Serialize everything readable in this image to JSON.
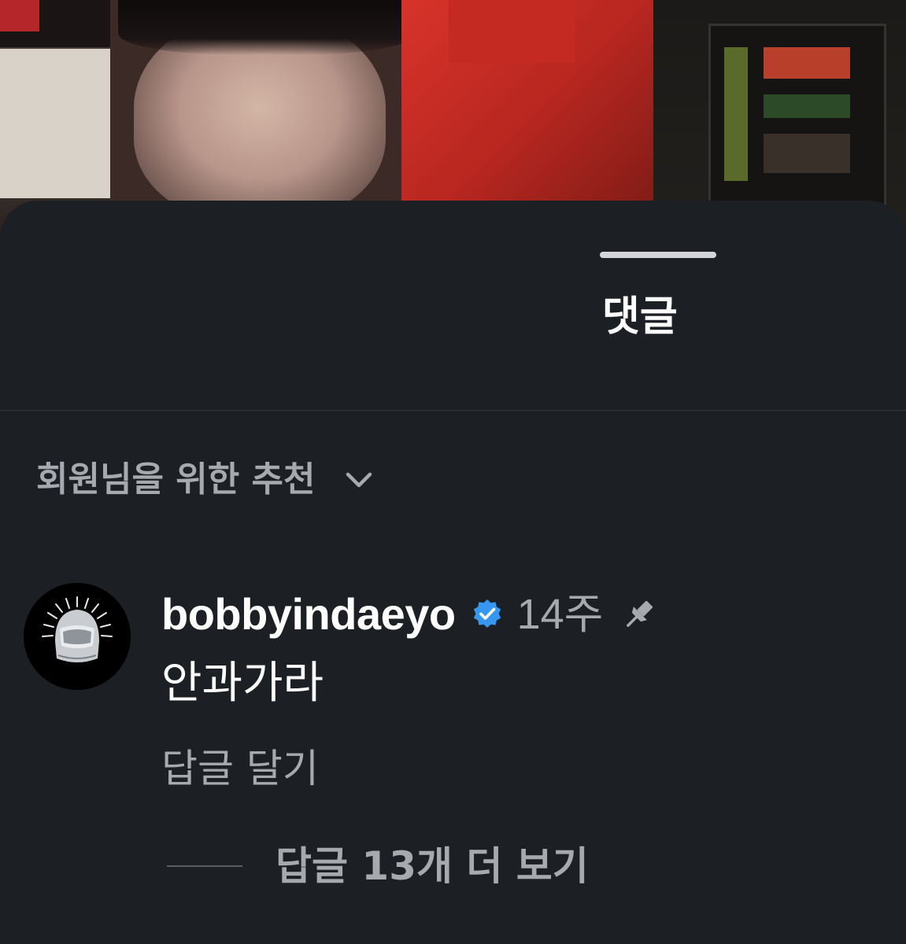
{
  "sheet": {
    "title": "댓글"
  },
  "sort": {
    "label": "회원님을 위한 추천",
    "icon": "chevron-down-icon"
  },
  "comment": {
    "username": "bobbyindaeyo",
    "verified": true,
    "verified_icon": "verified-badge-icon",
    "timestamp": "14주",
    "pinned": true,
    "pin_icon": "pin-icon",
    "text": "안과가라",
    "reply_label": "답글 달기",
    "view_replies_label": "답글 13개 더 보기",
    "avatar_icon": "helmet-avatar-icon"
  },
  "colors": {
    "background": "#1c1f24",
    "text_primary": "#ffffff",
    "text_secondary": "#a6a9ae",
    "verified_blue": "#3897f0"
  }
}
